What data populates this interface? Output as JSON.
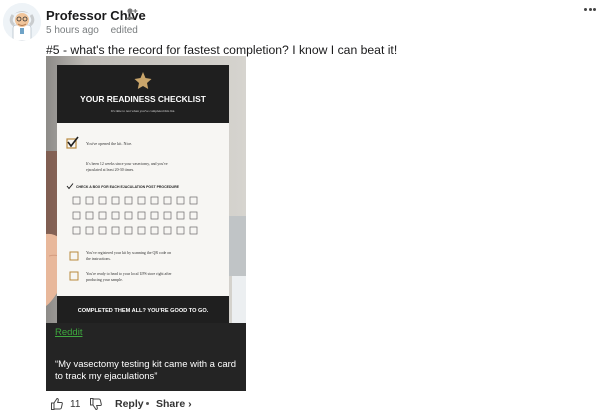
{
  "author": {
    "name": "Professor Chive"
  },
  "meta": {
    "time": "5 hours ago",
    "edited": "edited"
  },
  "comment": {
    "text": "#5 - what's the record for fastest completion? I know I can beat it!"
  },
  "card": {
    "title": "YOUR READINESS CHECKLIST",
    "subtitle": "It's time to test when you've completed this list.",
    "item1": "You've opened the kit. Nice.",
    "item2": "It's been 12 weeks since your vasectomy, and you've ejaculated at least 20-30 times.",
    "grid_header": "CHECK A BOX FOR EACH EJACULATION POST PROCEDURE",
    "item3": "You've registered your kit by scanning the QR code on the instructions.",
    "item4": "You're ready to head to your local UPS store right after producing your sample.",
    "footer": "COMPLETED THEM ALL? YOU'RE GOOD TO GO."
  },
  "caption": {
    "source": "Reddit",
    "text": "“My vasectomy testing kit came with a card to track my ejaculations”"
  },
  "actions": {
    "like_count": "11",
    "reply": "Reply",
    "share": "Share ›"
  },
  "icons": [
    "avatar",
    "add-friend-icon",
    "more-options-icon",
    "thumbs-up-icon",
    "thumbs-down-icon"
  ],
  "colors": {
    "caption_bg": "#242424",
    "source_link": "#3ea83e",
    "card_dark": "#1f1f1f"
  }
}
